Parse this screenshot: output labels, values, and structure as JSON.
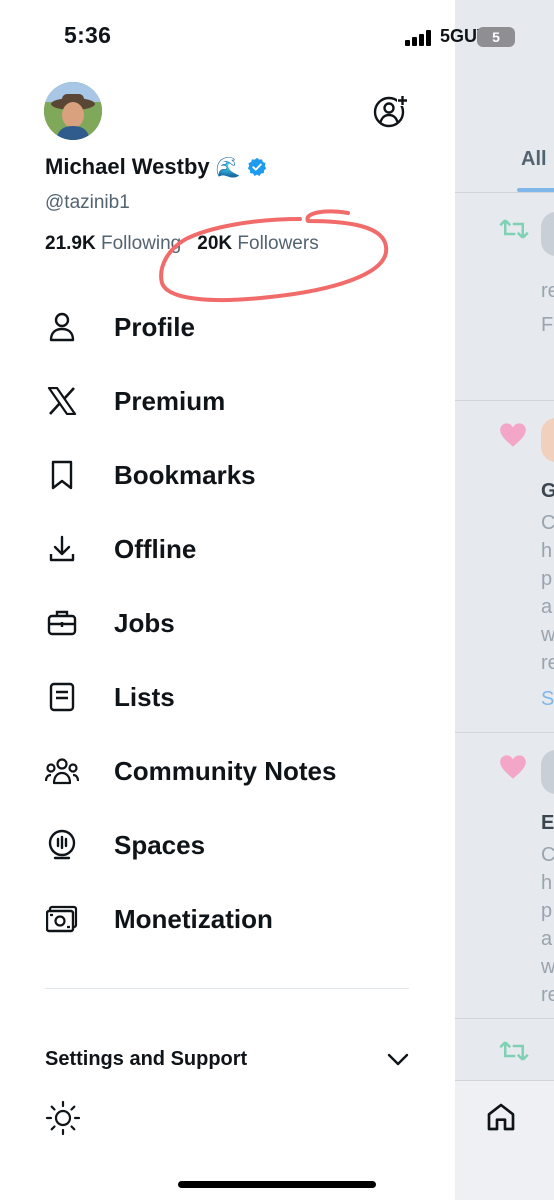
{
  "status_bar": {
    "time": "5:36",
    "network": "5GUW",
    "battery": "5"
  },
  "profile": {
    "name": "Michael Westby",
    "name_emoji": "🌊",
    "verified": true,
    "handle": "@tazinib1",
    "following_count": "21.9K",
    "following_label": "Following",
    "followers_count": "20K",
    "followers_label": "Followers"
  },
  "menu": {
    "items": [
      {
        "label": "Profile",
        "icon": "person-icon"
      },
      {
        "label": "Premium",
        "icon": "x-logo-icon"
      },
      {
        "label": "Bookmarks",
        "icon": "bookmark-icon"
      },
      {
        "label": "Offline",
        "icon": "download-icon"
      },
      {
        "label": "Jobs",
        "icon": "briefcase-icon"
      },
      {
        "label": "Lists",
        "icon": "list-icon"
      },
      {
        "label": "Community Notes",
        "icon": "community-icon"
      },
      {
        "label": "Spaces",
        "icon": "microphone-icon"
      },
      {
        "label": "Monetization",
        "icon": "money-icon"
      }
    ]
  },
  "settings": {
    "label": "Settings and Support"
  },
  "timeline_peek": {
    "tab_label": "All",
    "fragments": [
      "re",
      "F",
      "G",
      "C",
      "h",
      "p",
      "a",
      "w",
      "re",
      "S",
      "E",
      "C",
      "h",
      "p",
      "a",
      "w",
      "re"
    ]
  },
  "colors": {
    "verified": "#1d9bf0",
    "annotation": "#f26b6b",
    "retweet": "#00ba7c",
    "like": "#f91880"
  }
}
